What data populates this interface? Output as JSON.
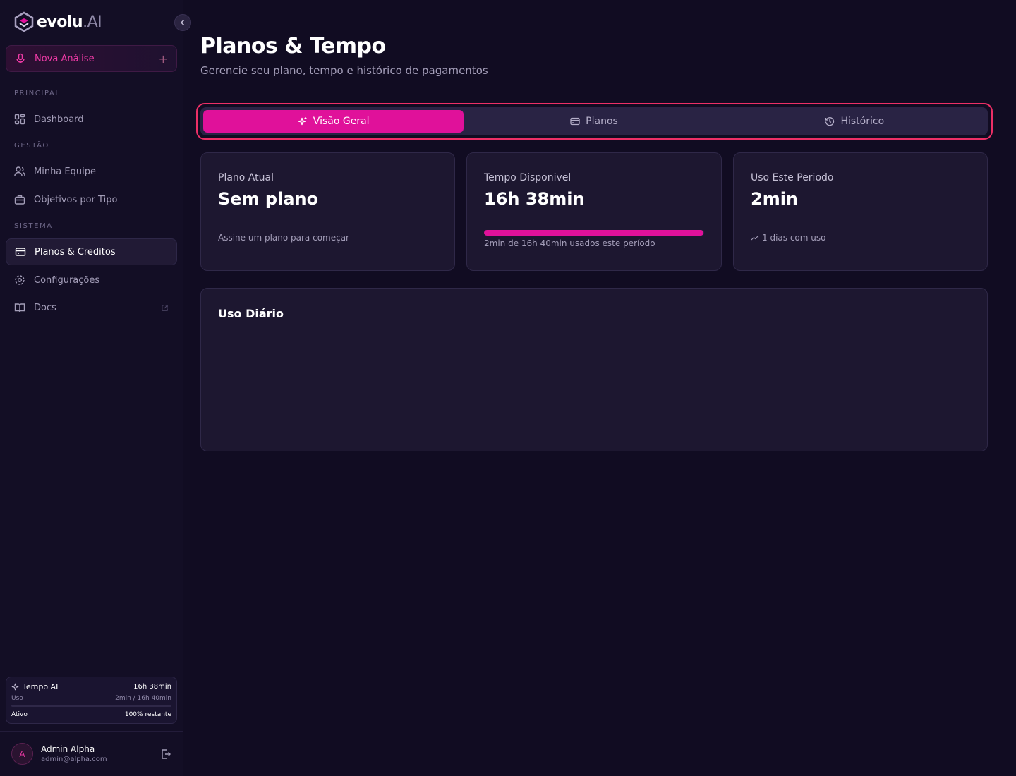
{
  "brand": {
    "name": "evolu",
    "suffix": ".AI"
  },
  "sidebar": {
    "new_button": "Nova Análise",
    "sections": {
      "principal": "PRINCIPAL",
      "gestao": "GESTÃO",
      "sistema": "SISTEMA"
    },
    "items": {
      "dashboard": "Dashboard",
      "team": "Minha Equipe",
      "objectives": "Objetivos por Tipo",
      "plans": "Planos & Creditos",
      "settings": "Configurações",
      "docs": "Docs"
    },
    "active_item": "plans",
    "tempo": {
      "title": "Tempo AI",
      "value": "16h 38min",
      "usage_label": "Uso",
      "usage_value": "2min / 16h 40min",
      "usage_fraction": 0.002,
      "status": "Ativo",
      "remaining": "100% restante"
    },
    "user": {
      "initial": "A",
      "name": "Admin Alpha",
      "email": "admin@alpha.com"
    }
  },
  "page": {
    "title": "Planos & Tempo",
    "subtitle": "Gerencie seu plano, tempo e histórico de pagamentos"
  },
  "tabs": [
    {
      "label": "Visão Geral",
      "icon": "sparkles-icon",
      "active": true
    },
    {
      "label": "Planos",
      "icon": "credit-card-icon",
      "active": false
    },
    {
      "label": "Histórico",
      "icon": "history-icon",
      "active": false
    }
  ],
  "cards": {
    "plan": {
      "label": "Plano Atual",
      "value": "Sem plano",
      "note": "Assine um plano para começar"
    },
    "time": {
      "label": "Tempo Disponivel",
      "value": "16h 38min",
      "note": "2min de 16h 40min usados este período",
      "remaining_fraction": 0.998
    },
    "usage": {
      "label": "Uso Este Periodo",
      "value": "2min",
      "note": "1 dias com uso"
    }
  },
  "daily": {
    "title": "Uso Diário"
  },
  "colors": {
    "accent": "#e0119a",
    "highlight": "#ec2f66",
    "background": "#110c22",
    "card": "#1d1730"
  }
}
